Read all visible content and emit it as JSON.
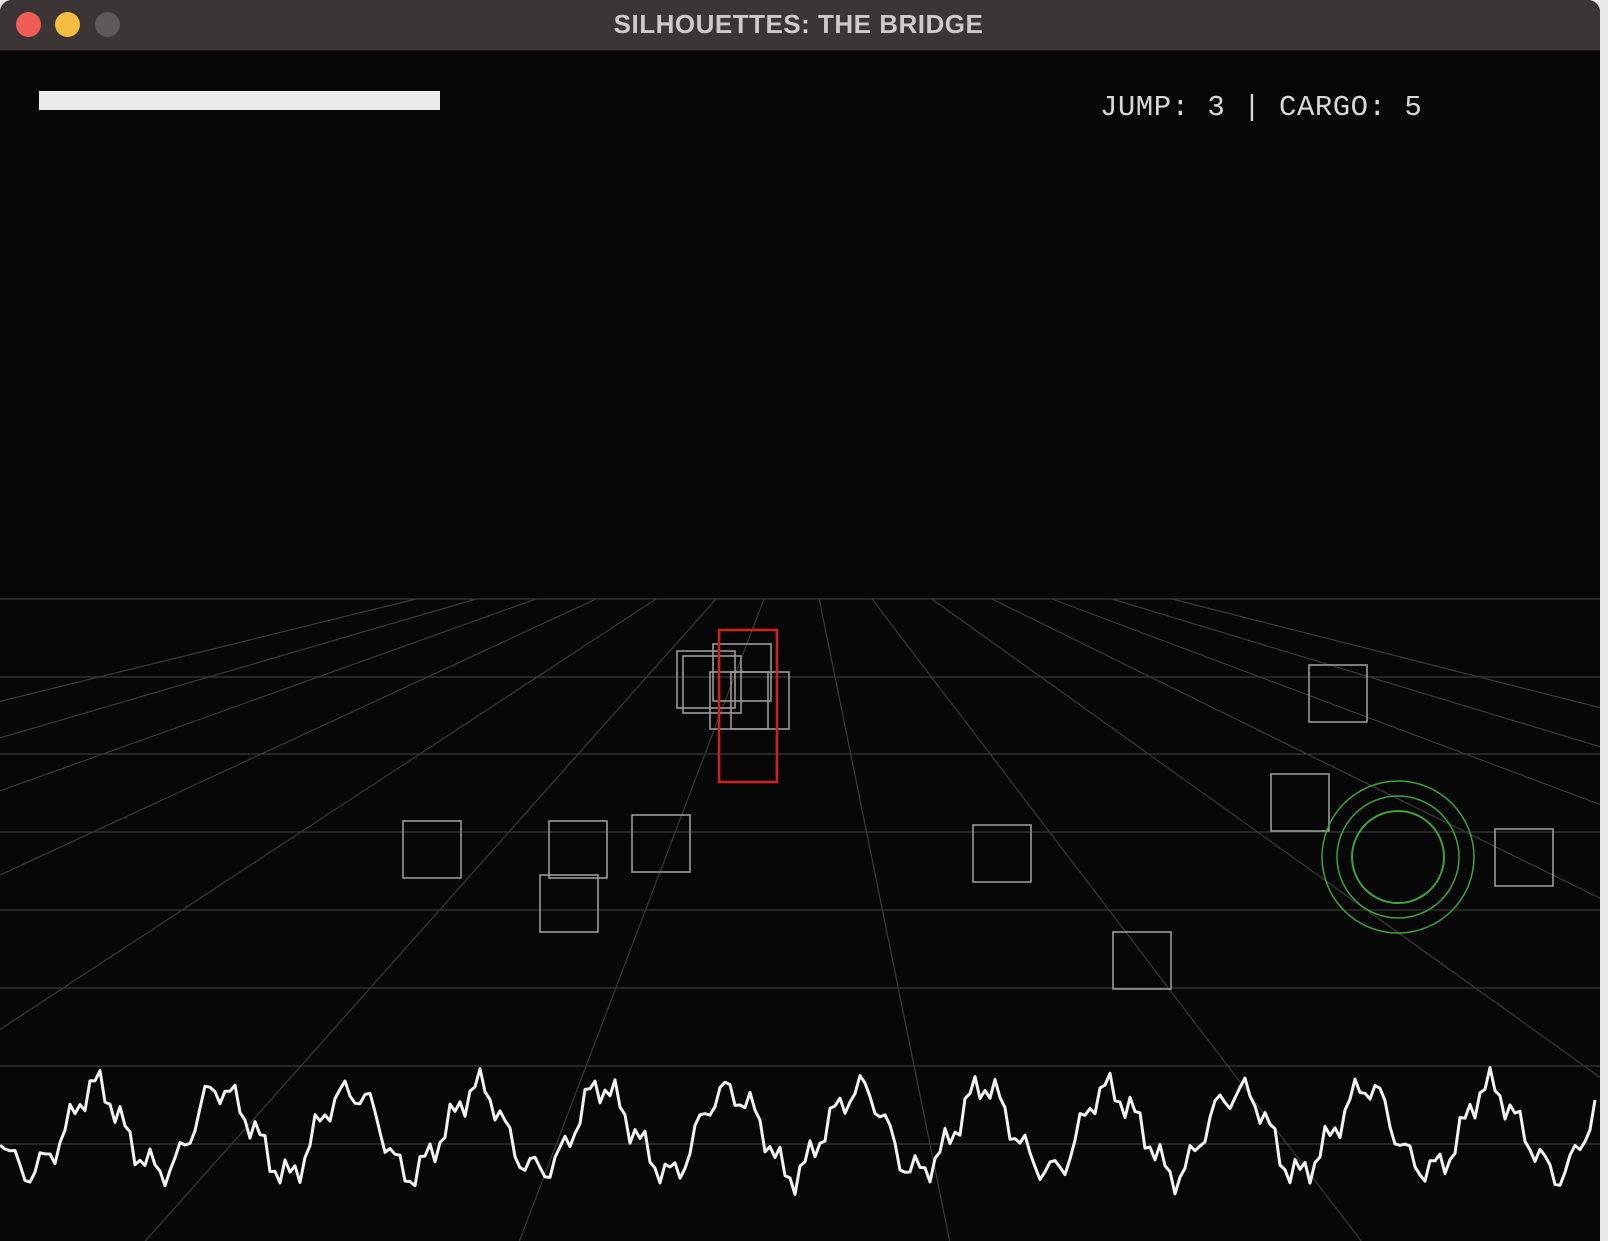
{
  "window": {
    "title": "SILHOUETTES: THE BRIDGE",
    "buttons": [
      "close",
      "minimize",
      "maximize"
    ]
  },
  "hud": {
    "jump_label": "JUMP:",
    "jump_value": "3",
    "separator": "|",
    "cargo_label": "CARGO:",
    "cargo_value": "5",
    "health_level": 1.0
  },
  "colors": {
    "background": "#070707",
    "grid": "#3a3a3a",
    "player": "#c8231f",
    "target_rings": "#3fa53a",
    "cargo_boxes": "#9a9a9a",
    "waveform": "#f2f2f2"
  },
  "entities": {
    "player": "ship",
    "target": "portal-rings",
    "cargo_count_visible": 15
  }
}
